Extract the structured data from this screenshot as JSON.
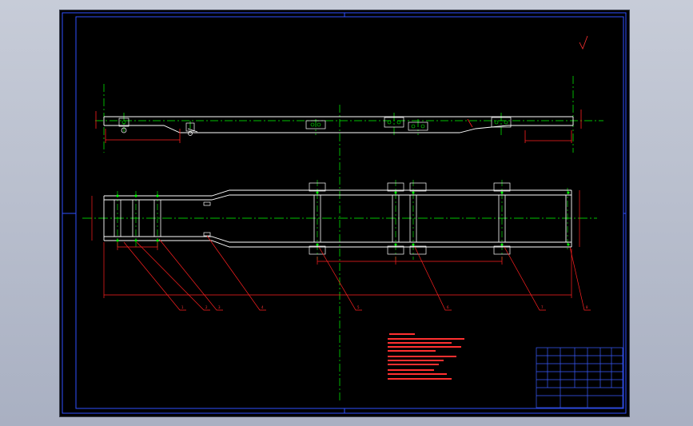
{
  "colors": {
    "background": "#000000",
    "frame": "#2f4fff",
    "geometry": "#ffffff",
    "centerline": "#00ff00",
    "dimension": "#ff2020",
    "annotation": "#ff3030",
    "title_block": "#3a5cff"
  },
  "surface_mark": "",
  "title_block": {
    "drawing_name": "",
    "scale_sheet": ""
  },
  "technical_notes": []
}
